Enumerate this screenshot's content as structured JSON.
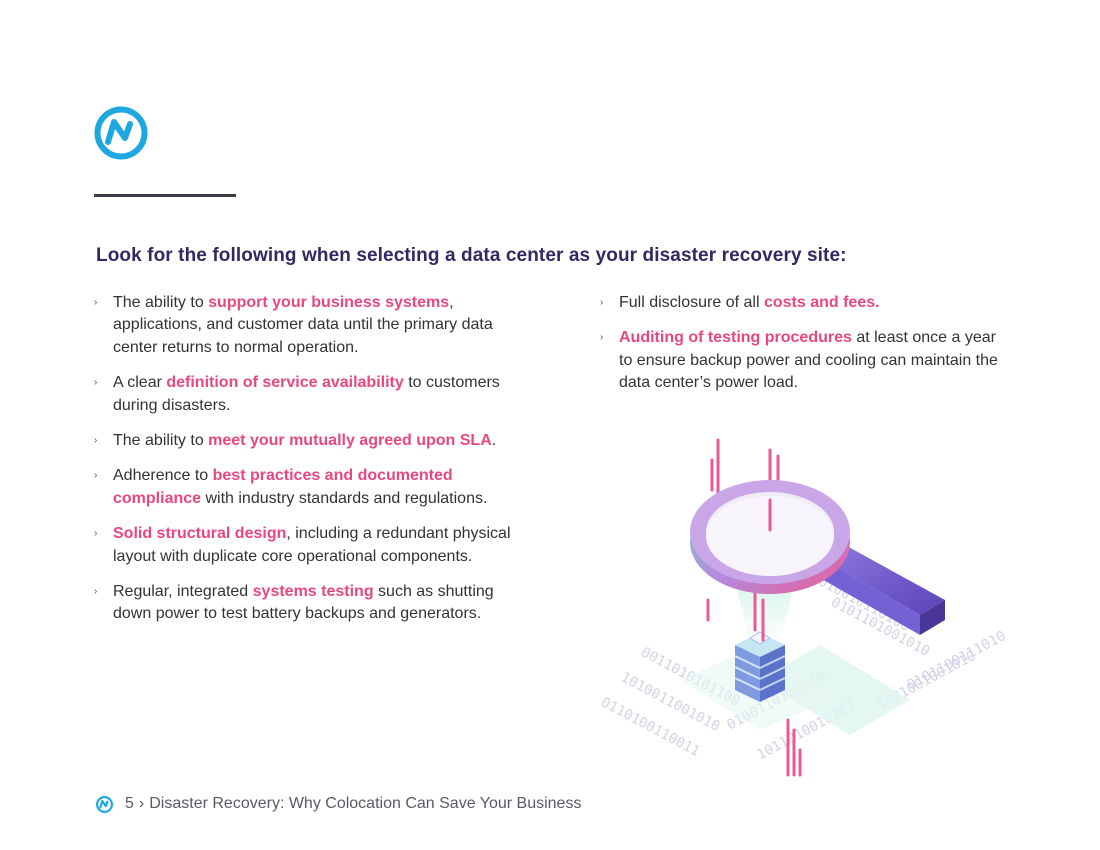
{
  "colors": {
    "brand": "#1ea8e0",
    "heading": "#2f2a63",
    "highlight": "#e8487e"
  },
  "heading": "Look for the following when selecting a data center as your disaster recovery site:",
  "left_items": [
    {
      "parts": [
        {
          "t": "The ability to ",
          "h": false
        },
        {
          "t": "support your business systems",
          "h": true
        },
        {
          "t": ", applications, and customer data until the primary data center returns to normal operation.",
          "h": false
        }
      ]
    },
    {
      "parts": [
        {
          "t": "A clear ",
          "h": false
        },
        {
          "t": "definition of service availability",
          "h": true
        },
        {
          "t": " to customers during disasters.",
          "h": false
        }
      ]
    },
    {
      "parts": [
        {
          "t": "The ability to ",
          "h": false
        },
        {
          "t": "meet your mutually agreed upon SLA",
          "h": true
        },
        {
          "t": ".",
          "h": false
        }
      ]
    },
    {
      "parts": [
        {
          "t": "Adherence to ",
          "h": false
        },
        {
          "t": "best practices and documented compliance",
          "h": true
        },
        {
          "t": " with industry standards and regulations.",
          "h": false
        }
      ]
    },
    {
      "parts": [
        {
          "t": "Solid structural design",
          "h": true
        },
        {
          "t": ", including a redundant physical layout with duplicate core operational components.",
          "h": false
        }
      ]
    },
    {
      "parts": [
        {
          "t": "Regular, integrated ",
          "h": false
        },
        {
          "t": "systems testing",
          "h": true
        },
        {
          "t": " such as shutting down power to test battery backups and generators.",
          "h": false
        }
      ]
    }
  ],
  "right_items": [
    {
      "parts": [
        {
          "t": "Full disclosure of all ",
          "h": false
        },
        {
          "t": "costs and fees.",
          "h": true
        }
      ]
    },
    {
      "parts": [
        {
          "t": "Auditing of testing procedures",
          "h": true
        },
        {
          "t": " at least once a year to ensure backup power and cooling can maintain the data center’s power load.",
          "h": false
        }
      ]
    }
  ],
  "footer": {
    "page": "5",
    "separator": "›",
    "title": "Disaster Recovery: Why Colocation Can Save Your Business"
  }
}
